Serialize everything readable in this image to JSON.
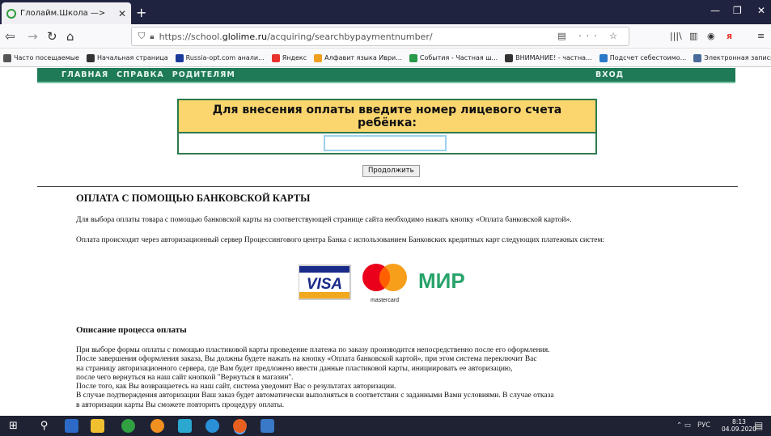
{
  "browser": {
    "tab_title": "Глолайм.Школа —>",
    "url_prefix": "https://school.",
    "url_host": "glolime.ru",
    "url_path": "/acquiring/searchbypaymentnumber/",
    "url_actions": "··· ☆"
  },
  "bookmarks": [
    {
      "label": "Часто посещаемые",
      "icon": "gear-icon",
      "color": "#555555"
    },
    {
      "label": "Начальная страница",
      "icon": "globe-icon",
      "color": "#333333"
    },
    {
      "label": "Russia-opt.com анали...",
      "icon": "ru-icon",
      "color": "#1a3a9a"
    },
    {
      "label": "Яндекс",
      "icon": "yandex-icon",
      "color": "#e8322b"
    },
    {
      "label": "Алфавит языка Иври...",
      "icon": "google-icon",
      "color": "#f0a020"
    },
    {
      "label": "События - Частная ш...",
      "icon": "m-icon",
      "color": "#2a9a4a"
    },
    {
      "label": "ВНИМАНИЕ! - частна...",
      "icon": "bars-icon",
      "color": "#333333"
    },
    {
      "label": "Подсчет себестоимо...",
      "icon": "sheet-icon",
      "color": "#2a7ac8"
    },
    {
      "label": "Электронная запись ...",
      "icon": "calendar-icon",
      "color": "#4a6a9a"
    }
  ],
  "site_nav": {
    "home": "ГЛАВНАЯ",
    "help": "СПРАВКА",
    "parents": "РОДИТЕЛЯМ",
    "login": "ВХОД"
  },
  "payment_form": {
    "heading": "Для внесения оплаты введите номер лицевого счета ребёнка:",
    "input_value": "",
    "button_label": "Продолжить"
  },
  "content": {
    "title": "ОПЛАТА С ПОМОЩЬЮ БАНКОВСКОЙ КАРТЫ",
    "paragraph1": "Для выбора оплаты товара с помощью банковской карты на соответствующей странице сайта необходимо нажать кнопку «Оплата банковской картой».",
    "paragraph2": "Оплата происходит через авторизационный сервер Процессингового центра Банка с использованием Банковских кредитных карт следующих платежных систем:",
    "cards": {
      "visa": "VISA",
      "mastercard": "mastercard",
      "mir": "МИР"
    },
    "subtitle": "Описание процесса оплаты",
    "description_lines": [
      "При выборе формы оплаты с помощью пластиковой карты проведение платежа по заказу производится непосредственно после его оформления.",
      "После завершения оформления заказа, Вы должны будете нажать на кнопку «Оплата банковской картой», при этом система переключит Вас",
      "на страницу авторизационного сервера, где Вам будет предложено ввести данные пластиковой карты, инициировать ее авторизацию,",
      "после чего вернуться на наш сайт кнопкой \"Вернуться в магазин\".",
      "После того, как Вы возвращаетесь на наш сайт, система уведомит Вас о результатах авторизации.",
      "В случае подтверждения авторизации Ваш заказ будет автоматически выполняться в соответствии с заданными Вами условиями. В случае отказа",
      "в авторизации карты Вы сможете повторить процедуру оплаты."
    ]
  },
  "taskbar": {
    "language": "РУС",
    "time": "8:13",
    "date": "04.09.2020"
  }
}
